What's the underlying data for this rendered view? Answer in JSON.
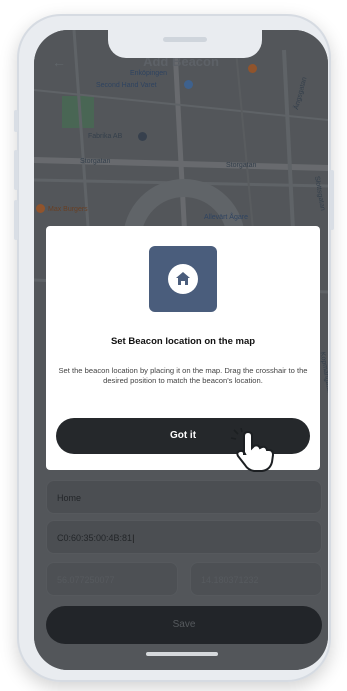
{
  "header": {
    "back_icon": "arrow-left-icon",
    "title": "Add Beacon"
  },
  "map": {
    "labels": {
      "place1": "Enköpingen",
      "place2": "Second Hand Varet",
      "place3": "Fabrika AB",
      "street1": "Storgatan",
      "street2": "Storgatan",
      "place4": "Max Burgers",
      "place5": "Allevärt Ågare",
      "street3": "Ängsgatan",
      "street4": "Slottsgatan",
      "street5": "Kopmangatan"
    },
    "colors": {
      "road": "#8a8d8f",
      "park": "#4e9a62",
      "water": "#5a7ea0"
    }
  },
  "modal": {
    "icon": "home-icon",
    "title": "Set Beacon location on the map",
    "body": "Set the beacon location by placing it on the map. Drag the crosshair to the desired position to match the beacon's location.",
    "button_label": "Got it"
  },
  "form": {
    "name_value": "Home",
    "mac_value": "C0:60:35:00:4B:81",
    "latitude_value": "56.077250077",
    "longitude_value": "14.180371232",
    "save_label": "Save"
  },
  "pointer": {
    "icon": "hand-pointer-icon"
  }
}
